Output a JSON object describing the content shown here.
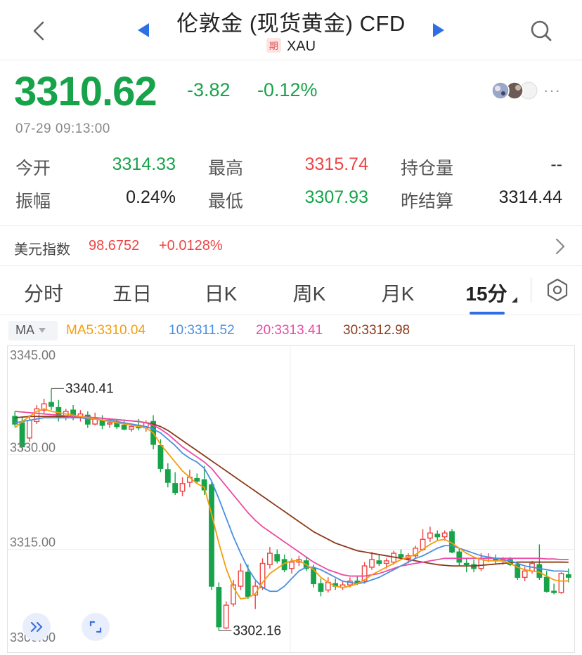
{
  "header": {
    "title": "伦敦金 (现货黄金) CFD",
    "badge": "期",
    "code": "XAU"
  },
  "quote": {
    "price": "3310.62",
    "change": "-3.82",
    "change_pct": "-0.12%",
    "time": "07-29 09:13:00",
    "more": "···"
  },
  "stats": [
    {
      "label": "今开",
      "value": "3314.33",
      "color": "#16a34a"
    },
    {
      "label": "最高",
      "value": "3315.74",
      "color": "#ef4444"
    },
    {
      "label": "持仓量",
      "value": "--",
      "color": "#222222"
    },
    {
      "label": "振幅",
      "value": "0.24%",
      "color": "#222222"
    },
    {
      "label": "最低",
      "value": "3307.93",
      "color": "#16a34a"
    },
    {
      "label": "昨结算",
      "value": "3314.44",
      "color": "#222222"
    }
  ],
  "dxy": {
    "label": "美元指数",
    "value": "98.6752",
    "change": "+0.0128%"
  },
  "tabs": [
    {
      "label": "分时"
    },
    {
      "label": "五日"
    },
    {
      "label": "日K"
    },
    {
      "label": "周K"
    },
    {
      "label": "月K"
    },
    {
      "label": "15分",
      "active": true
    }
  ],
  "ma_select": "MA",
  "ma_legend": [
    {
      "text": "MA5:3310.04",
      "color": "#f59e0b"
    },
    {
      "text": "10:3311.52",
      "color": "#4a8fe2"
    },
    {
      "text": "20:3313.41",
      "color": "#ec4aa6"
    },
    {
      "text": "30:3312.98",
      "color": "#8b3a1a"
    }
  ],
  "chart_data": {
    "type": "candlestick",
    "y_range": [
      3300,
      3345
    ],
    "y_ticks": [
      "3345.00",
      "3330.00",
      "3315.00",
      "3300.00"
    ],
    "y_tick_values": [
      3345,
      3330,
      3315,
      3300
    ],
    "high_label": "3340.41",
    "high_value": 3340.41,
    "low_label": "3302.16",
    "low_value": 3302.16,
    "up_color": "#ef4444",
    "down_color": "#16a34a",
    "candles": [
      [
        3336.0,
        3336.8,
        3334.4,
        3334.8
      ],
      [
        3335.0,
        3336.0,
        3330.6,
        3331.2
      ],
      [
        3332.6,
        3336.2,
        3332.0,
        3335.4
      ],
      [
        3335.2,
        3337.8,
        3334.8,
        3337.2
      ],
      [
        3337.0,
        3338.8,
        3336.4,
        3338.0
      ],
      [
        3338.2,
        3340.41,
        3337.0,
        3337.6
      ],
      [
        3337.4,
        3338.6,
        3335.2,
        3335.8
      ],
      [
        3335.8,
        3337.2,
        3335.4,
        3336.8
      ],
      [
        3337.0,
        3337.8,
        3335.4,
        3335.8
      ],
      [
        3336.0,
        3337.0,
        3335.2,
        3336.4
      ],
      [
        3336.2,
        3336.8,
        3334.2,
        3334.8
      ],
      [
        3334.8,
        3336.6,
        3334.6,
        3335.8
      ],
      [
        3335.4,
        3336.2,
        3334.0,
        3334.6
      ],
      [
        3334.8,
        3335.6,
        3334.2,
        3335.0
      ],
      [
        3335.0,
        3335.6,
        3334.0,
        3334.4
      ],
      [
        3334.6,
        3335.4,
        3333.8,
        3334.0
      ],
      [
        3334.0,
        3334.8,
        3333.6,
        3334.4
      ],
      [
        3334.6,
        3335.6,
        3333.8,
        3334.2
      ],
      [
        3334.2,
        3335.4,
        3333.6,
        3335.0
      ],
      [
        3335.2,
        3336.2,
        3330.8,
        3331.6
      ],
      [
        3331.4,
        3332.4,
        3327.2,
        3327.8
      ],
      [
        3327.6,
        3328.6,
        3324.8,
        3325.6
      ],
      [
        3325.4,
        3327.2,
        3323.6,
        3324.0
      ],
      [
        3324.2,
        3326.4,
        3323.4,
        3325.4
      ],
      [
        3325.6,
        3327.6,
        3324.8,
        3326.4
      ],
      [
        3326.2,
        3327.0,
        3325.4,
        3325.8
      ],
      [
        3326.0,
        3328.2,
        3323.6,
        3324.4
      ],
      [
        3325.2,
        3325.6,
        3308.6,
        3309.2
      ],
      [
        3309.0,
        3309.8,
        3302.16,
        3302.8
      ],
      [
        3302.6,
        3306.8,
        3302.4,
        3306.2
      ],
      [
        3306.4,
        3310.2,
        3306.0,
        3309.4
      ],
      [
        3309.2,
        3312.8,
        3308.6,
        3311.6
      ],
      [
        3311.4,
        3312.6,
        3307.2,
        3307.6
      ],
      [
        3307.8,
        3310.0,
        3305.6,
        3309.2
      ],
      [
        3309.0,
        3313.6,
        3308.6,
        3312.8
      ],
      [
        3312.6,
        3315.4,
        3312.0,
        3314.4
      ],
      [
        3314.2,
        3315.0,
        3312.8,
        3313.2
      ],
      [
        3313.4,
        3314.2,
        3311.4,
        3311.8
      ],
      [
        3312.0,
        3313.6,
        3311.2,
        3313.0
      ],
      [
        3313.0,
        3314.0,
        3312.4,
        3313.4
      ],
      [
        3313.2,
        3313.8,
        3311.6,
        3312.0
      ],
      [
        3312.0,
        3312.6,
        3309.0,
        3309.6
      ],
      [
        3309.6,
        3310.4,
        3307.6,
        3308.4
      ],
      [
        3308.6,
        3310.6,
        3308.2,
        3309.8
      ],
      [
        3309.6,
        3310.4,
        3308.6,
        3309.2
      ],
      [
        3309.0,
        3310.0,
        3308.6,
        3309.4
      ],
      [
        3309.4,
        3310.6,
        3309.0,
        3310.0
      ],
      [
        3310.0,
        3310.8,
        3309.4,
        3309.8
      ],
      [
        3310.0,
        3313.0,
        3309.6,
        3312.4
      ],
      [
        3312.2,
        3314.6,
        3311.8,
        3313.4
      ],
      [
        3313.2,
        3314.2,
        3312.4,
        3312.8
      ],
      [
        3312.8,
        3313.6,
        3312.0,
        3313.2
      ],
      [
        3313.0,
        3314.8,
        3312.6,
        3314.4
      ],
      [
        3314.2,
        3315.0,
        3313.4,
        3313.8
      ],
      [
        3313.6,
        3314.4,
        3312.8,
        3314.0
      ],
      [
        3314.0,
        3315.6,
        3313.6,
        3315.2
      ],
      [
        3315.0,
        3318.2,
        3314.8,
        3316.6
      ],
      [
        3316.8,
        3318.6,
        3316.2,
        3317.6
      ],
      [
        3317.4,
        3318.0,
        3316.4,
        3317.0
      ],
      [
        3317.0,
        3318.0,
        3316.4,
        3317.6
      ],
      [
        3317.8,
        3318.2,
        3314.4,
        3314.6
      ],
      [
        3314.6,
        3315.2,
        3312.4,
        3313.0
      ],
      [
        3312.8,
        3313.6,
        3311.4,
        3312.6
      ],
      [
        3312.6,
        3313.4,
        3311.4,
        3312.0
      ],
      [
        3312.0,
        3314.4,
        3311.6,
        3313.6
      ],
      [
        3313.6,
        3314.4,
        3313.0,
        3313.8
      ],
      [
        3313.6,
        3314.2,
        3312.8,
        3313.2
      ],
      [
        3313.2,
        3313.8,
        3312.6,
        3313.4
      ],
      [
        3313.4,
        3313.8,
        3312.4,
        3312.6
      ],
      [
        3312.6,
        3313.0,
        3310.2,
        3310.6
      ],
      [
        3310.6,
        3312.2,
        3310.0,
        3311.6
      ],
      [
        3311.6,
        3313.2,
        3311.2,
        3312.8
      ],
      [
        3312.6,
        3315.8,
        3310.2,
        3310.6
      ],
      [
        3310.6,
        3311.6,
        3308.2,
        3308.4
      ],
      [
        3308.4,
        3309.6,
        3307.93,
        3308.2
      ],
      [
        3308.2,
        3311.4,
        3308.0,
        3311.2
      ],
      [
        3311.0,
        3312.0,
        3309.8,
        3310.62
      ]
    ],
    "ma5": [
      3334.2,
      3335.2,
      3336.0,
      3336.8,
      3337.2,
      3336.8,
      3336.6,
      3336.4,
      3336.2,
      3336.0,
      3335.8,
      3335.6,
      3335.4,
      3335.2,
      3335.0,
      3334.8,
      3334.6,
      3334.4,
      3334.2,
      3333.4,
      3331.6,
      3330.2,
      3328.8,
      3327.4,
      3326.4,
      3325.4,
      3324.8,
      3320.6,
      3316.0,
      3312.0,
      3309.0,
      3307.2,
      3307.4,
      3308.0,
      3309.8,
      3311.2,
      3312.0,
      3312.8,
      3313.2,
      3313.2,
      3312.6,
      3311.8,
      3310.6,
      3309.8,
      3309.2,
      3309.0,
      3309.2,
      3309.6,
      3310.2,
      3311.0,
      3311.6,
      3312.2,
      3312.8,
      3313.4,
      3313.8,
      3314.2,
      3315.0,
      3315.8,
      3316.4,
      3316.6,
      3316.0,
      3315.2,
      3314.4,
      3313.8,
      3313.4,
      3313.2,
      3313.2,
      3313.2,
      3312.8,
      3312.2,
      3311.8,
      3311.6,
      3311.4,
      3310.8,
      3310.2,
      3310.0,
      3310.04
    ],
    "ma10": [
      3335.0,
      3335.2,
      3335.4,
      3335.6,
      3335.8,
      3335.8,
      3335.8,
      3335.8,
      3335.8,
      3335.8,
      3335.6,
      3335.6,
      3335.4,
      3335.4,
      3335.2,
      3335.0,
      3334.8,
      3334.6,
      3334.4,
      3334.0,
      3333.4,
      3332.4,
      3331.4,
      3330.2,
      3329.4,
      3328.8,
      3327.8,
      3325.8,
      3323.0,
      3320.0,
      3317.0,
      3314.4,
      3312.0,
      3310.2,
      3309.0,
      3308.4,
      3308.4,
      3309.2,
      3310.4,
      3311.6,
      3312.2,
      3312.2,
      3311.8,
      3311.2,
      3310.6,
      3310.0,
      3309.8,
      3309.6,
      3309.8,
      3310.2,
      3310.6,
      3311.2,
      3311.8,
      3312.4,
      3313.0,
      3313.6,
      3314.0,
      3314.6,
      3315.2,
      3315.6,
      3315.6,
      3315.2,
      3314.8,
      3314.4,
      3314.0,
      3313.8,
      3313.6,
      3313.4,
      3313.2,
      3312.8,
      3312.4,
      3312.2,
      3312.0,
      3311.8,
      3311.6,
      3311.6,
      3311.52
    ],
    "ma20": [
      3336.8,
      3336.7,
      3336.6,
      3336.5,
      3336.4,
      3336.3,
      3336.2,
      3336.1,
      3336.0,
      3336.0,
      3335.9,
      3335.8,
      3335.7,
      3335.6,
      3335.5,
      3335.4,
      3335.3,
      3335.2,
      3335.0,
      3334.6,
      3334.0,
      3333.2,
      3332.2,
      3331.2,
      3330.4,
      3329.6,
      3328.8,
      3327.8,
      3326.4,
      3325.0,
      3323.6,
      3322.2,
      3320.8,
      3319.6,
      3318.6,
      3317.8,
      3317.0,
      3316.2,
      3315.4,
      3314.6,
      3313.8,
      3313.0,
      3312.4,
      3311.8,
      3311.4,
      3311.0,
      3310.8,
      3310.8,
      3310.8,
      3311.0,
      3311.2,
      3311.6,
      3312.0,
      3312.4,
      3312.6,
      3312.8,
      3313.0,
      3313.2,
      3313.4,
      3313.6,
      3313.6,
      3313.6,
      3313.6,
      3313.6,
      3313.6,
      3313.6,
      3313.6,
      3313.6,
      3313.6,
      3313.6,
      3313.6,
      3313.6,
      3313.6,
      3313.5,
      3313.5,
      3313.4,
      3313.41
    ],
    "ma30": [
      3335.8,
      3335.9,
      3336.0,
      3336.0,
      3336.0,
      3336.0,
      3336.0,
      3336.0,
      3336.0,
      3335.9,
      3335.8,
      3335.8,
      3335.7,
      3335.6,
      3335.5,
      3335.4,
      3335.3,
      3335.2,
      3335.0,
      3334.8,
      3334.4,
      3333.8,
      3333.0,
      3332.2,
      3331.4,
      3330.6,
      3329.8,
      3329.0,
      3328.2,
      3327.4,
      3326.6,
      3325.8,
      3325.0,
      3324.2,
      3323.4,
      3322.6,
      3321.8,
      3321.0,
      3320.2,
      3319.4,
      3318.6,
      3317.8,
      3317.2,
      3316.6,
      3316.0,
      3315.6,
      3315.2,
      3314.8,
      3314.6,
      3314.4,
      3314.2,
      3314.0,
      3313.8,
      3313.6,
      3313.4,
      3313.2,
      3313.0,
      3312.8,
      3312.6,
      3312.5,
      3312.4,
      3312.4,
      3312.4,
      3312.4,
      3312.5,
      3312.6,
      3312.7,
      3312.8,
      3312.9,
      3313.0,
      3313.0,
      3313.0,
      3313.0,
      3313.0,
      3313.0,
      3313.0,
      3312.98
    ]
  }
}
